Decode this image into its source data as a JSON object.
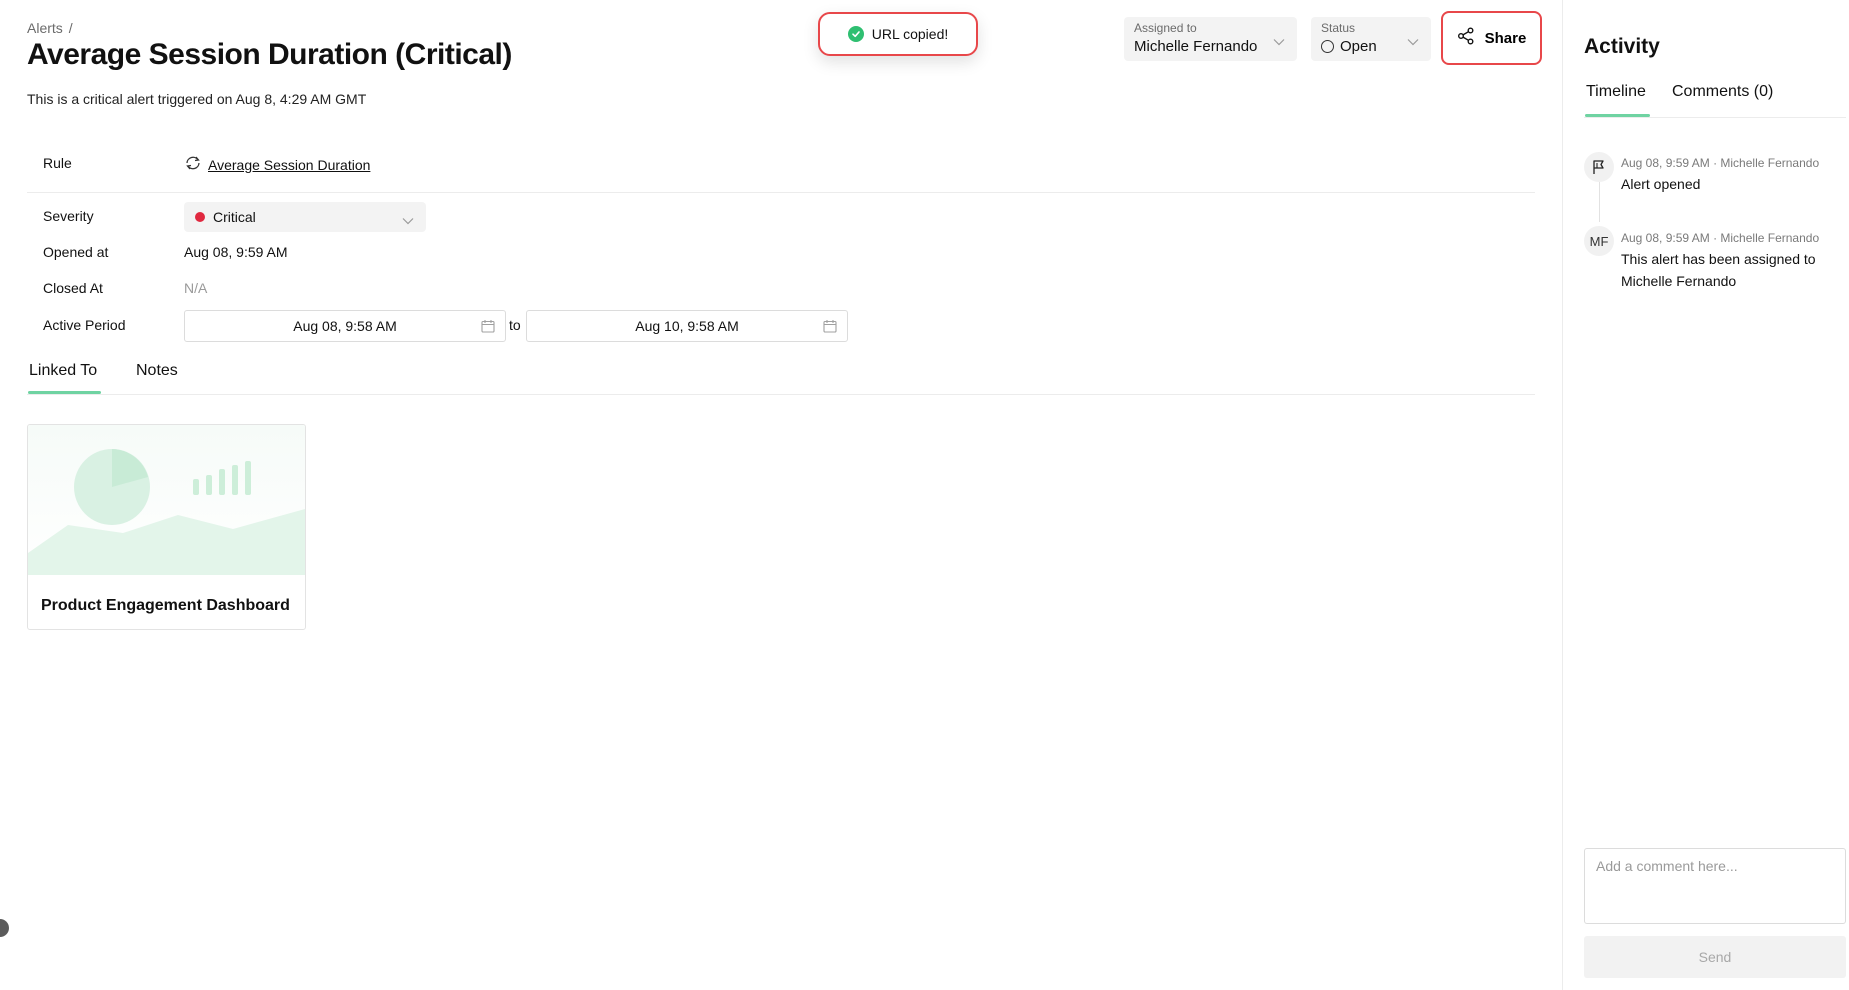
{
  "breadcrumb": {
    "root": "Alerts",
    "separator": "/"
  },
  "header": {
    "title": "Average Session Duration (Critical)",
    "subtitle": "This is a critical alert triggered on Aug 8, 4:29 AM GMT"
  },
  "toast": {
    "text": "URL copied!",
    "icon": "check-circle-icon",
    "color": "#2fbf71"
  },
  "assigned": {
    "label": "Assigned to",
    "value": "Michelle Fernando"
  },
  "status": {
    "label": "Status",
    "value": "Open"
  },
  "share": {
    "label": "Share",
    "icon": "share-icon"
  },
  "details": {
    "rule_label": "Rule",
    "rule_value": "Average Session Duration",
    "severity_label": "Severity",
    "severity_value": "Critical",
    "severity_color": "#e0283f",
    "opened_label": "Opened at",
    "opened_value": "Aug 08, 9:59 AM",
    "closed_label": "Closed At",
    "closed_value": "N/A",
    "period_label": "Active Period",
    "period_start": "Aug 08, 9:58 AM",
    "period_sep": "to",
    "period_end": "Aug 10, 9:58 AM"
  },
  "tabs": {
    "linked": "Linked To",
    "notes": "Notes",
    "active": "Linked To"
  },
  "linked_card": {
    "title": "Product Engagement Dashboard"
  },
  "activity": {
    "title": "Activity",
    "tab_timeline": "Timeline",
    "tab_comments": "Comments (0)",
    "events": [
      {
        "meta": "Aug 08, 9:59 AM · Michelle Fernando",
        "text": "Alert opened",
        "icon": "flag-icon"
      },
      {
        "meta": "Aug 08, 9:59 AM · Michelle Fernando",
        "text": "This alert has been assigned to Michelle Fernando",
        "initials": "MF"
      }
    ],
    "comment_placeholder": "Add a comment here...",
    "send_label": "Send"
  },
  "colors": {
    "accent_green": "#6fd3a2",
    "highlight_red": "#e8474a"
  }
}
